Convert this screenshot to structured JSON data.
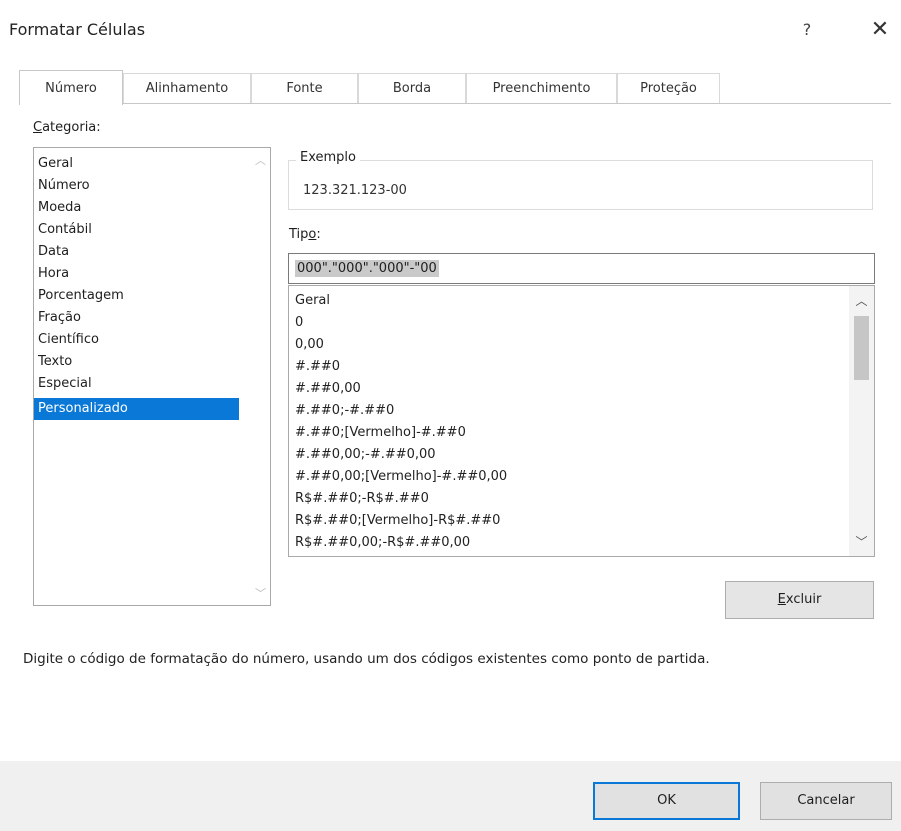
{
  "window": {
    "title": "Formatar Células",
    "help_glyph": "?",
    "close_glyph": "✕"
  },
  "tabs": [
    {
      "label": "Número",
      "active": true
    },
    {
      "label": "Alinhamento",
      "active": false
    },
    {
      "label": "Fonte",
      "active": false
    },
    {
      "label": "Borda",
      "active": false
    },
    {
      "label": "Preenchimento",
      "active": false
    },
    {
      "label": "Proteção",
      "active": false
    }
  ],
  "category": {
    "label_hotkey": "C",
    "label_rest": "ategoria:",
    "items": [
      "Geral",
      "Número",
      "Moeda",
      "Contábil",
      "Data",
      "Hora",
      "Porcentagem",
      "Fração",
      "Científico",
      "Texto",
      "Especial",
      "Personalizado"
    ],
    "selected": "Personalizado"
  },
  "example": {
    "legend": "Exemplo",
    "value": "123.321.123-00"
  },
  "type": {
    "label_start": "Tip",
    "label_hotkey": "o",
    "label_end": ":",
    "value": "000\".\"000\".\"000\"-\"00"
  },
  "format_list": [
    "Geral",
    "0",
    "0,00",
    "#.##0",
    "#.##0,00",
    "#.##0;-#.##0",
    "#.##0;[Vermelho]-#.##0",
    "#.##0,00;-#.##0,00",
    "#.##0,00;[Vermelho]-#.##0,00",
    "R$#.##0;-R$#.##0",
    "R$#.##0;[Vermelho]-R$#.##0",
    "R$#.##0,00;-R$#.##0,00"
  ],
  "buttons": {
    "delete_hotkey": "E",
    "delete_rest": "xcluir",
    "ok": "OK",
    "cancel": "Cancelar"
  },
  "hint": "Digite o código de formatação do número, usando um dos códigos existentes como ponto de partida.",
  "colors": {
    "selection": "#0a78d7",
    "footer": "#f0f0f0"
  }
}
